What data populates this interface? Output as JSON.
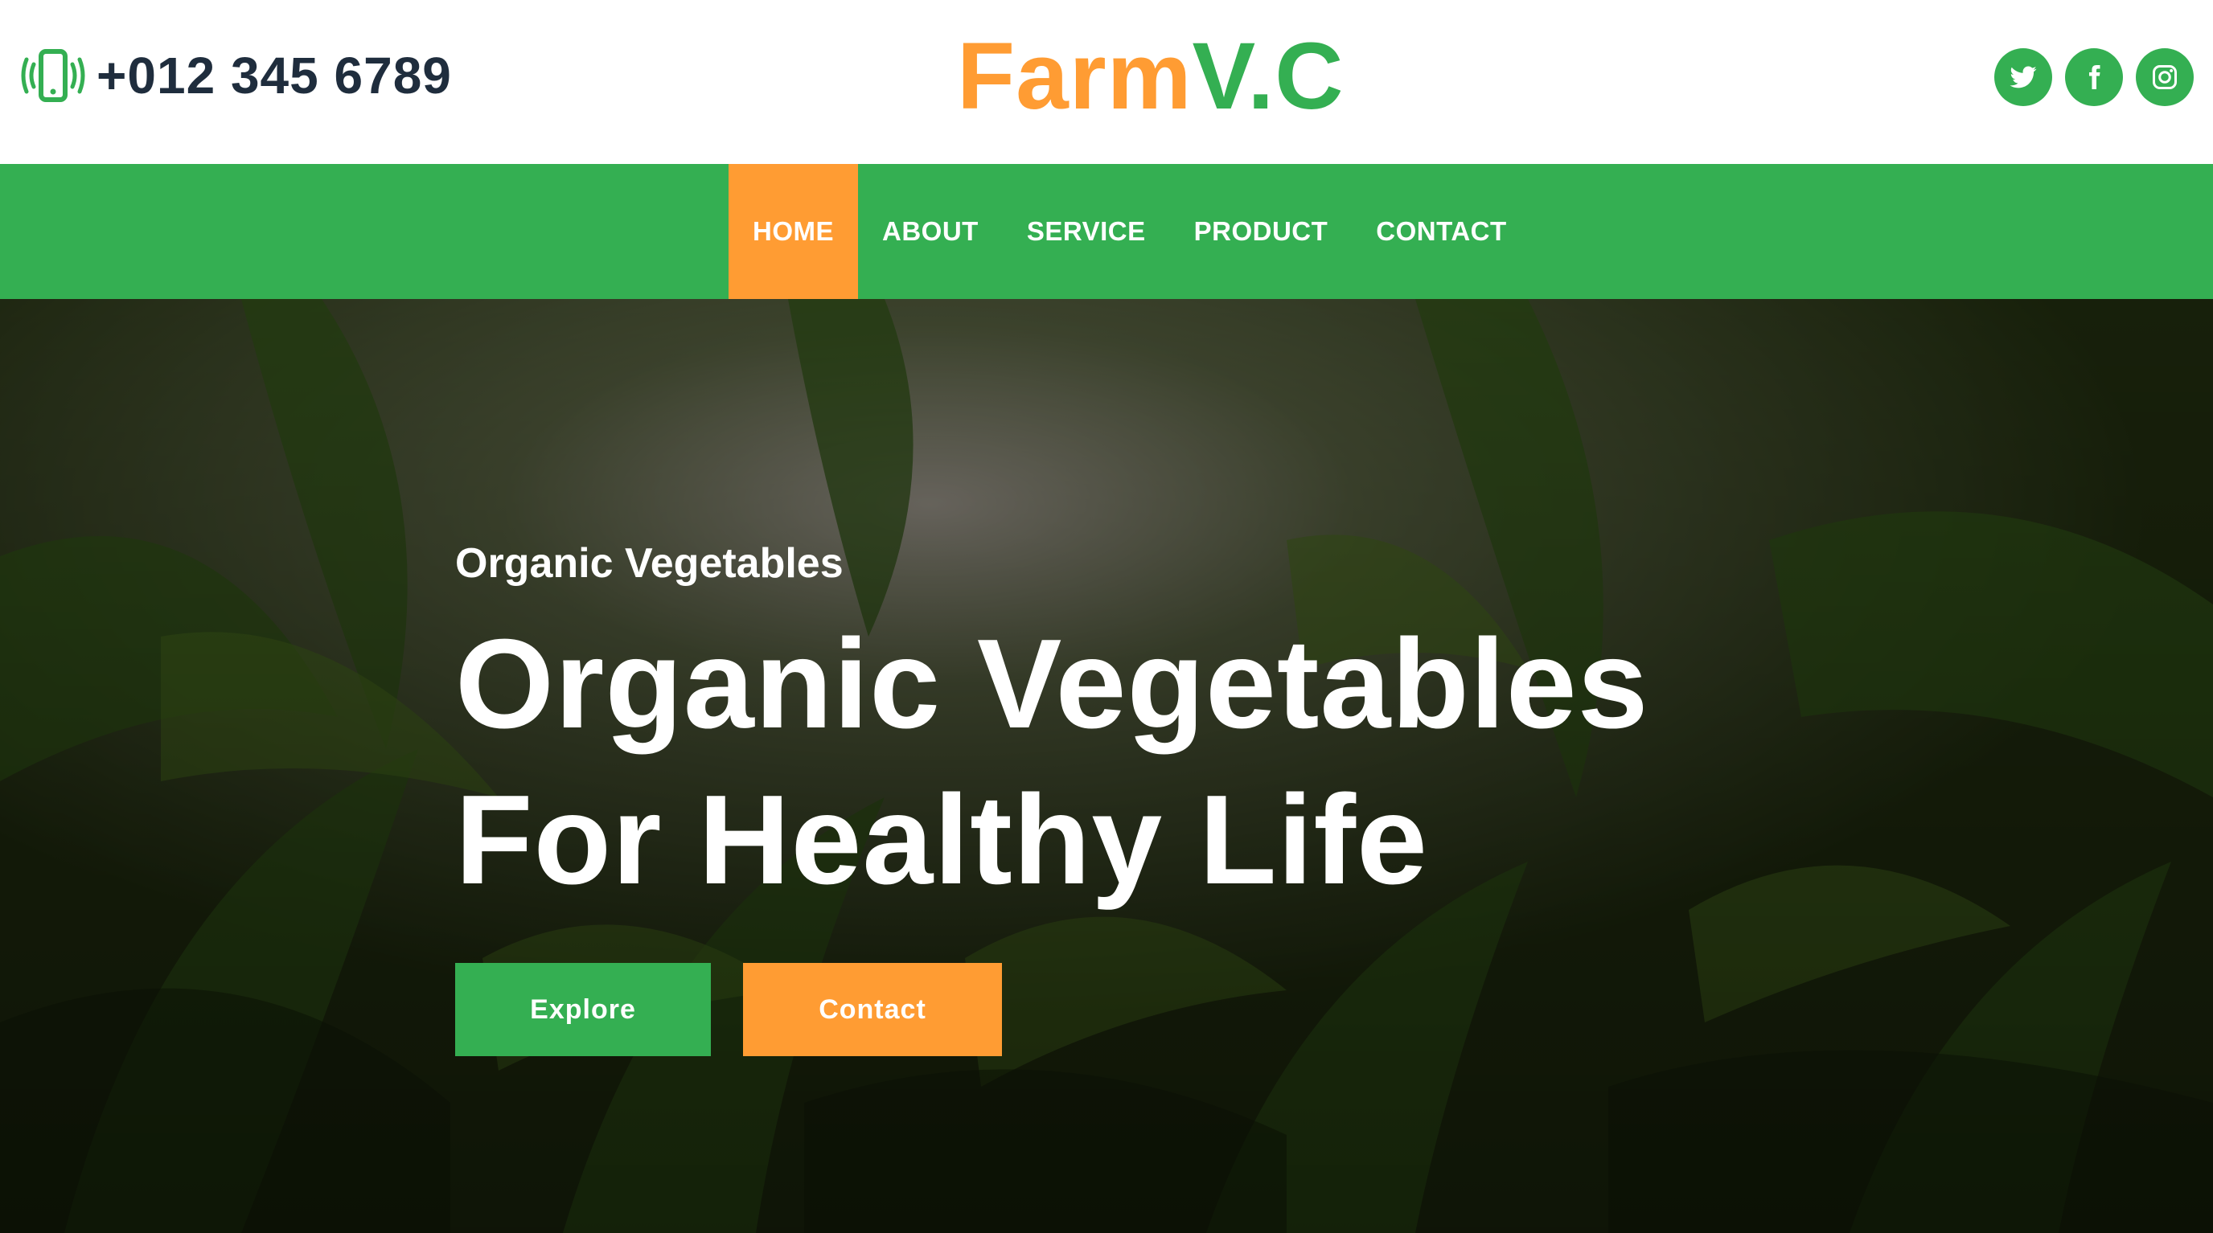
{
  "header": {
    "phone": "+012 345 6789",
    "phone_icon": "mobile-phone-vibrate-icon",
    "logo_part1": "Farm",
    "logo_part2": "V.C",
    "socials": [
      {
        "name": "twitter",
        "icon": "twitter-icon"
      },
      {
        "name": "facebook",
        "icon": "facebook-icon"
      },
      {
        "name": "instagram",
        "icon": "instagram-icon"
      }
    ]
  },
  "nav": {
    "items": [
      {
        "label": "HOME",
        "active": true
      },
      {
        "label": "ABOUT",
        "active": false
      },
      {
        "label": "SERVICE",
        "active": false
      },
      {
        "label": "PRODUCT",
        "active": false
      },
      {
        "label": "CONTACT",
        "active": false
      }
    ]
  },
  "hero": {
    "subtitle": "Organic Vegetables",
    "title_line1": "Organic Vegetables",
    "title_line2": "For Healthy Life",
    "explore_label": "Explore",
    "contact_label": "Contact"
  },
  "colors": {
    "green": "#34af52",
    "orange": "#ff9c33",
    "dark_text": "#1f2d3d"
  }
}
